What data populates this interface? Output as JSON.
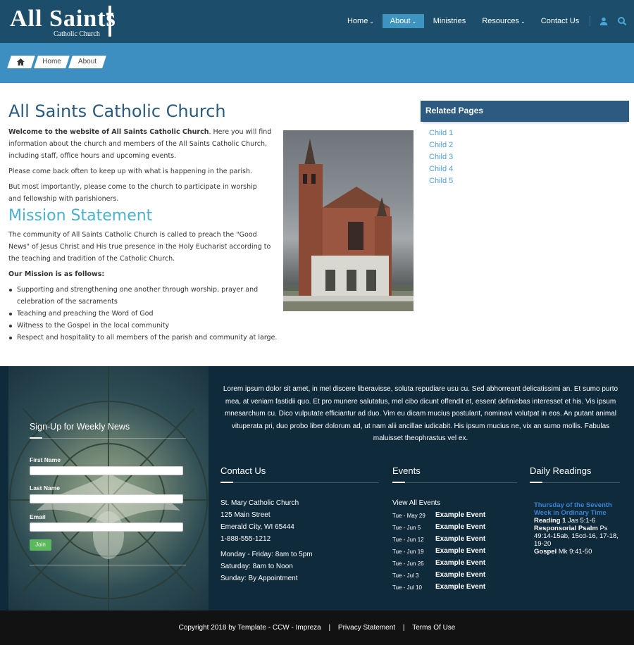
{
  "header": {
    "logo_text": "All Saints",
    "logo_sub": "Catholic Church",
    "nav": {
      "home": "Home",
      "about": "About",
      "ministries": "Ministries",
      "resources": "Resources",
      "contact": "Contact Us"
    },
    "icons": [
      "user-icon",
      "search-icon"
    ],
    "colors": {
      "header_bg": "#1c4e6b",
      "active_nav": "#3e94c1",
      "banner": "#3d8ec1"
    }
  },
  "breadcrumb": {
    "home_icon": "home-icon",
    "items": [
      "Home",
      "About"
    ]
  },
  "main": {
    "title": "All Saints Catholic Church",
    "intro_bold": "Welcome to the website of All Saints Catholic Church",
    "intro_rest": ". Here you will find information about the church and members of the All Saints Catholic Church, including staff, office hours and upcoming events.",
    "para2": "Please come back often to keep up with what is happening in the parish.",
    "para3": "But most importantly, please come to the church to participate in worship and fellowship with parishioners.",
    "mission_title": "Mission Statement",
    "mission_text": "The community of All Saints Catholic Church is called to preach the \"Good News\" of Jesus Christ and His true presence in the Holy Eucharist according to the teaching and tradition of the Catholic Church.",
    "mission_sub": "Our Mission is as follows:",
    "mission_list": [
      "Supporting and strengthening one another through worship, prayer and celebration of the sacraments",
      "Teaching and preaching the Word of God",
      "Witness to the Gospel in the local community",
      "Respect and hospitality to all members of the parish and community at large."
    ]
  },
  "sidebar": {
    "title": "Related Pages",
    "children": [
      "Child 1",
      "Child 2",
      "Child 3",
      "Child 4",
      "Child 5"
    ]
  },
  "signup": {
    "title": "Sign-Up for Weekly News",
    "first_name": "First Name",
    "last_name": "Last Name",
    "email": "Email",
    "join": "Join"
  },
  "footer": {
    "lorem": "Lorem ipsum dolor sit amet, in mel discere liberavisse, soluta repudiare usu cu. Sed abhorreant delicatissimi an. Et sumo purto mea, at veniam fastidii quo. Et pro munere salutatus, mel cibo dicunt offendit et, essent definiebas interesset et his. Vis ipsum mnesarchum cu. Dico vulputate efficiantur ad duo. Vim eu dicam mucius postulant, nominavi volutpat in eos. An putant animal vituperata pri, duo probo liber dolorum ad, ut nam alii ancillae iudicabit. His ipsum mucius ne, vix an sumo mollis. Fabulas maluisset theophrastus vel ex.",
    "contact": {
      "title": "Contact Us",
      "lines": [
        "St. Mary Catholic Church",
        "125 Main Street",
        "Emerald City, WI  65444",
        "1-888-555-1212",
        "Monday - Friday: 8am to 5pm",
        "Saturday: 8am to Noon",
        "Sunday: By Appointment"
      ]
    },
    "events": {
      "title": "Events",
      "view_all": "View All Events",
      "items": [
        {
          "date": "Tue - May 29",
          "name": "Example Event"
        },
        {
          "date": "Tue - Jun 5",
          "name": "Example Event"
        },
        {
          "date": "Tue - Jun 12",
          "name": "Example Event"
        },
        {
          "date": "Tue - Jun 19",
          "name": "Example Event"
        },
        {
          "date": "Tue - Jun 26",
          "name": "Example Event"
        },
        {
          "date": "Tue - Jul 3",
          "name": "Example Event"
        },
        {
          "date": "Tue - Jul 10",
          "name": "Example Event"
        }
      ]
    },
    "readings": {
      "title": "Daily Readings",
      "day": "Thursday of the Seventh Week in Ordinary Time",
      "reading1_label": "Reading 1",
      "reading1": "Jas 5:1-6",
      "psalm_label": "Responsorial Psalm",
      "psalm": "Ps 49:14-15ab, 15cd-16, 17-18, 19-20",
      "gospel_label": "Gospel",
      "gospel": "Mk 9:41-50"
    },
    "copyright": "Copyright 2018 by Template - CCW - Impreza",
    "privacy": "Privacy Statement",
    "terms": "Terms Of Use",
    "separator": "|"
  }
}
